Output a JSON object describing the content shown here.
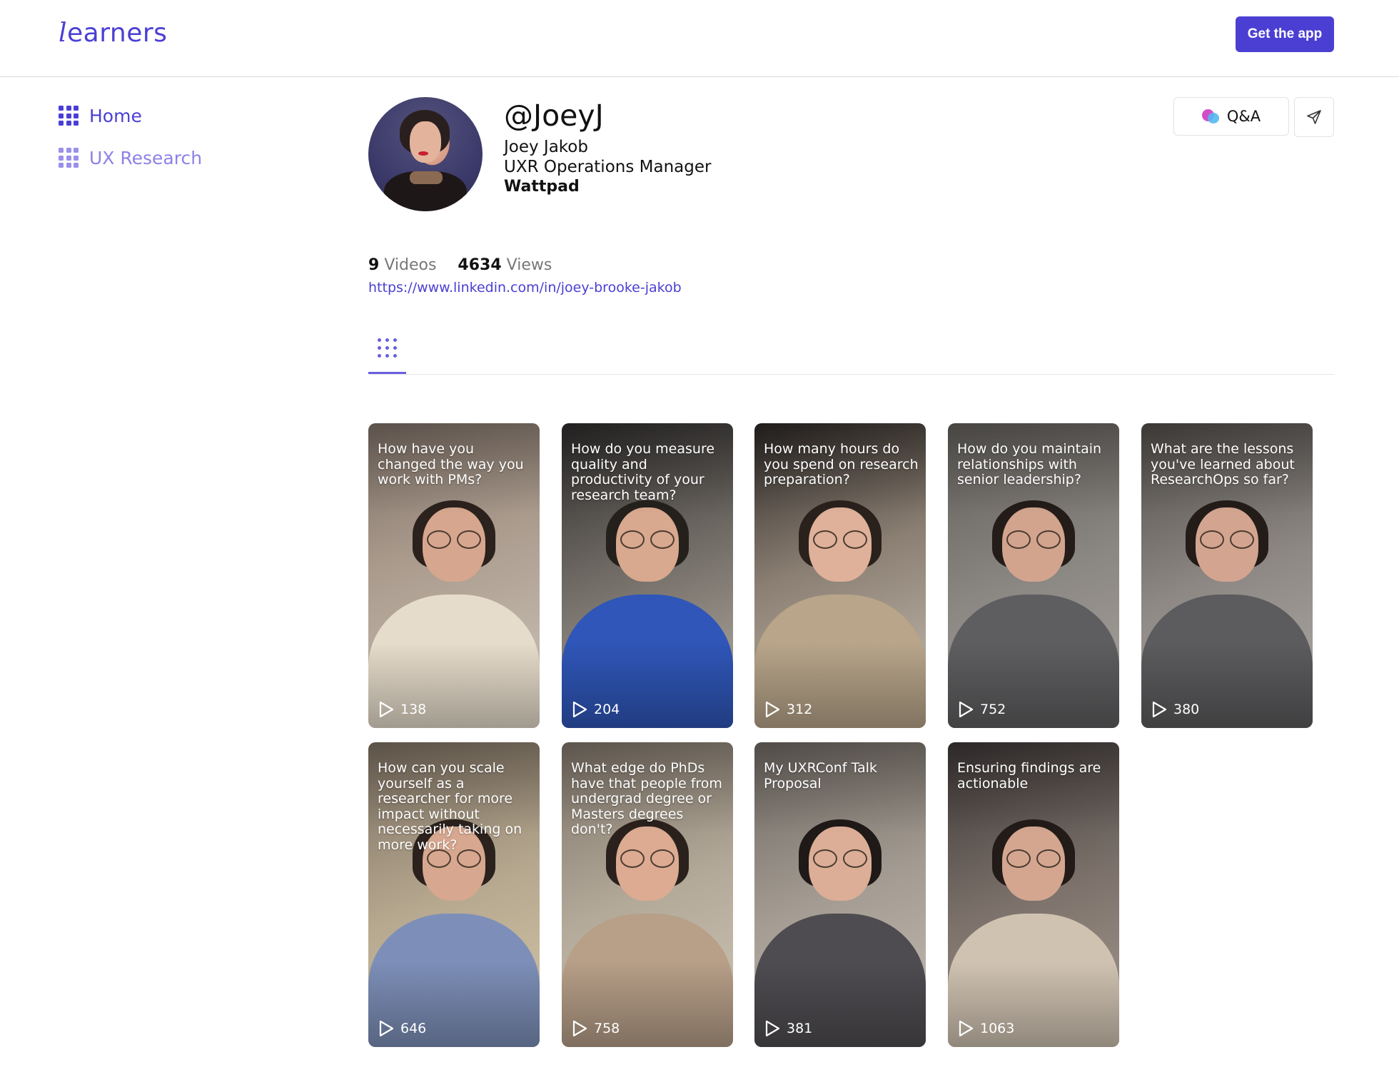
{
  "header": {
    "logo_first": "l",
    "logo_rest": "earners",
    "get_app_label": "Get the app"
  },
  "sidebar": {
    "items": [
      {
        "label": "Home",
        "icon": "grid-icon",
        "active": true
      },
      {
        "label": "UX Research",
        "icon": "grid-icon",
        "active": false
      }
    ]
  },
  "profile": {
    "handle": "@JoeyJ",
    "name": "Joey Jakob",
    "title": "UXR Operations Manager",
    "company": "Wattpad",
    "qa_label": "Q&A",
    "videos_count": "9",
    "videos_label": "Videos",
    "views_count": "4634",
    "views_label": "Views",
    "link": "https://www.linkedin.com/in/joey-brooke-jakob"
  },
  "colors": {
    "accent": "#4b3fd3",
    "accent_light": "#9a90ea"
  },
  "videos": [
    {
      "title": "How have you changed the way you work with PMs?",
      "plays": "138"
    },
    {
      "title": "How do you measure quality and productivity of your research team?",
      "plays": "204"
    },
    {
      "title": "How many hours do you spend on research preparation?",
      "plays": "312"
    },
    {
      "title": "How do you maintain relationships with senior leadership?",
      "plays": "752"
    },
    {
      "title": "What are the lessons you've learned about ResearchOps so far?",
      "plays": "380"
    },
    {
      "title": "How can you scale yourself as a researcher for more impact without necessarily taking on more work?",
      "plays": "646"
    },
    {
      "title": "What edge do PhDs have that people from undergrad degree or Masters degrees don't?",
      "plays": "758"
    },
    {
      "title": "My UXRConf Talk Proposal",
      "plays": "381"
    },
    {
      "title": "Ensuring findings are actionable",
      "plays": "1063"
    }
  ]
}
